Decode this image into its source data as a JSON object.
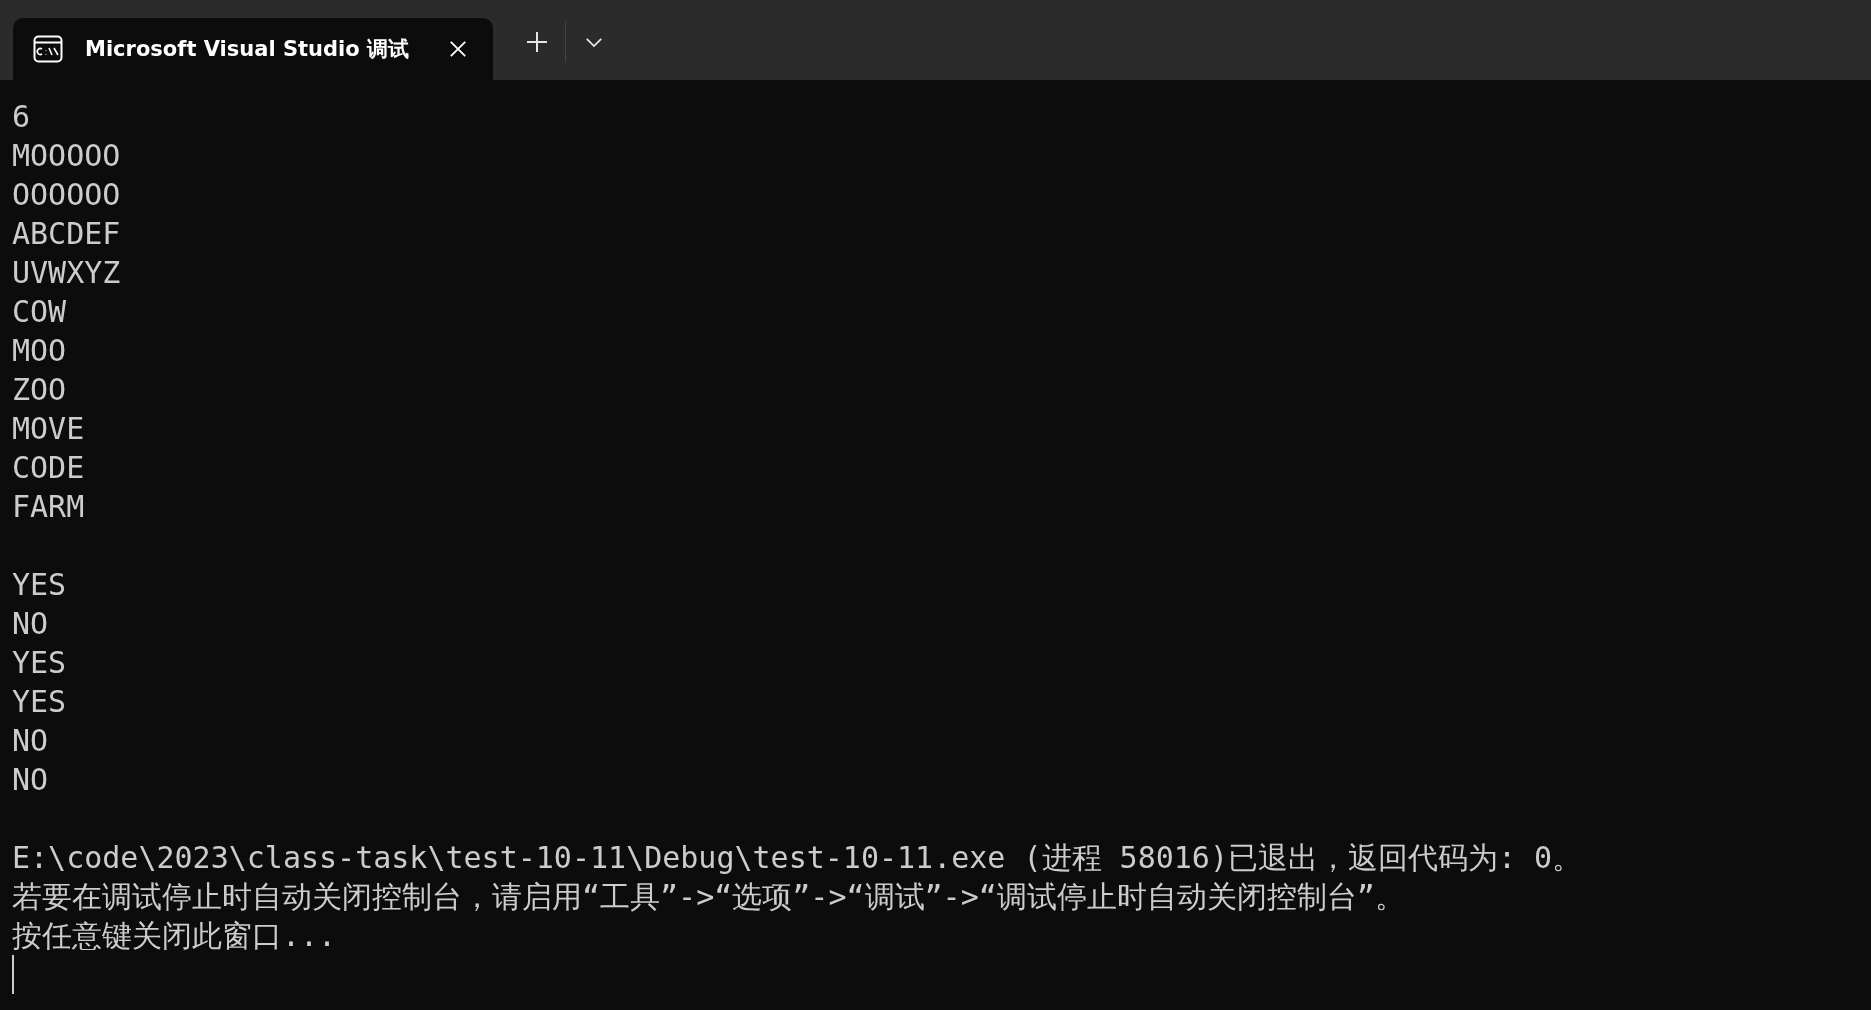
{
  "tabs": [
    {
      "title": "Microsoft Visual Studio 调试",
      "selected": true
    }
  ],
  "terminal": {
    "blocks": [
      [
        "6",
        "MOOOOO",
        "OOOOOO",
        "ABCDEF",
        "UVWXYZ",
        "COW",
        "MOO",
        "ZOO",
        "MOVE",
        "CODE",
        "FARM"
      ],
      [
        "YES",
        "NO",
        "YES",
        "YES",
        "NO",
        "NO"
      ],
      [
        "E:\\code\\2023\\class-task\\test-10-11\\Debug\\test-10-11.exe (进程 58016)已退出，返回代码为: 0。",
        "若要在调试停止时自动关闭控制台，请启用“工具”->“选项”->“调试”->“调试停止时自动关闭控制台”。",
        "按任意键关闭此窗口..."
      ]
    ]
  }
}
